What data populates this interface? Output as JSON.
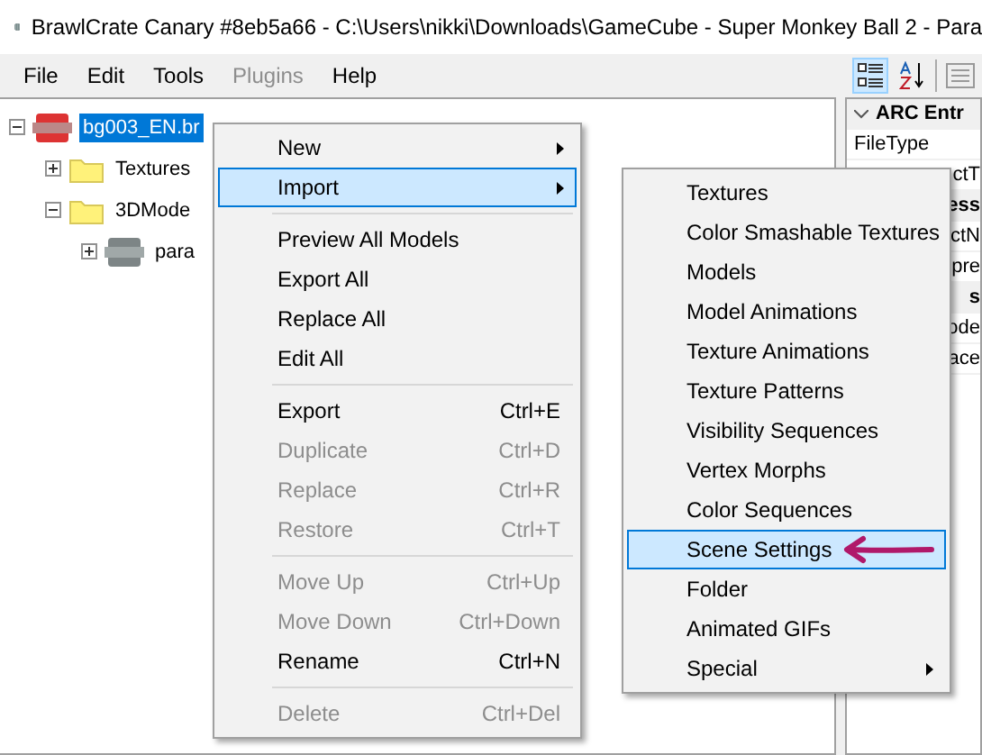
{
  "window": {
    "title": "BrawlCrate Canary #8eb5a66 - C:\\Users\\nikki\\Downloads\\GameCube - Super Monkey Ball 2 - Para"
  },
  "menu_bar": [
    {
      "label": "File",
      "disabled": false
    },
    {
      "label": "Edit",
      "disabled": false
    },
    {
      "label": "Tools",
      "disabled": false
    },
    {
      "label": "Plugins",
      "disabled": true
    },
    {
      "label": "Help",
      "disabled": false
    }
  ],
  "toolbar": [
    {
      "kind": "categorized",
      "selected": true
    },
    {
      "kind": "alphabetical",
      "selected": false
    },
    {
      "kind": "pages",
      "selected": false
    }
  ],
  "tree": [
    {
      "label": "bg003_EN.br",
      "kind": "bres",
      "expanded": true,
      "selected": true,
      "children": [
        {
          "label": "Textures",
          "kind": "folder",
          "expanded": false,
          "selected": false
        },
        {
          "label": "3DMode",
          "kind": "folder",
          "expanded": true,
          "selected": false,
          "children": [
            {
              "label": "para",
              "kind": "model",
              "expanded": false,
              "selected": false
            }
          ]
        }
      ]
    }
  ],
  "properties": [
    {
      "kind": "category",
      "label": "ARC Entr"
    },
    {
      "kind": "property",
      "label": "FileType"
    },
    {
      "kind": "property",
      "label": "ctT"
    },
    {
      "kind": "category",
      "label": "ess"
    },
    {
      "kind": "property",
      "label": "ctN"
    },
    {
      "kind": "property",
      "label": "pre"
    },
    {
      "kind": "category",
      "label": "s"
    },
    {
      "kind": "property",
      "label": "ode"
    },
    {
      "kind": "property",
      "label": "ace"
    }
  ],
  "context_menu": [
    {
      "kind": "item",
      "label": "New",
      "disabled": false,
      "submenu": true,
      "selected": false
    },
    {
      "kind": "item",
      "label": "Import",
      "disabled": false,
      "submenu": true,
      "selected": true
    },
    {
      "kind": "separator"
    },
    {
      "kind": "item",
      "label": "Preview All Models",
      "disabled": false,
      "submenu": false,
      "selected": false
    },
    {
      "kind": "item",
      "label": "Export All",
      "disabled": false,
      "submenu": false,
      "selected": false
    },
    {
      "kind": "item",
      "label": "Replace All",
      "disabled": false,
      "submenu": false,
      "selected": false
    },
    {
      "kind": "item",
      "label": "Edit All",
      "disabled": false,
      "submenu": false,
      "selected": false
    },
    {
      "kind": "separator"
    },
    {
      "kind": "item",
      "label": "Export",
      "shortcut": "Ctrl+E",
      "disabled": false,
      "submenu": false,
      "selected": false
    },
    {
      "kind": "item",
      "label": "Duplicate",
      "shortcut": "Ctrl+D",
      "disabled": true,
      "submenu": false,
      "selected": false
    },
    {
      "kind": "item",
      "label": "Replace",
      "shortcut": "Ctrl+R",
      "disabled": true,
      "submenu": false,
      "selected": false
    },
    {
      "kind": "item",
      "label": "Restore",
      "shortcut": "Ctrl+T",
      "disabled": true,
      "submenu": false,
      "selected": false
    },
    {
      "kind": "separator"
    },
    {
      "kind": "item",
      "label": "Move Up",
      "shortcut": "Ctrl+Up",
      "disabled": true,
      "submenu": false,
      "selected": false
    },
    {
      "kind": "item",
      "label": "Move Down",
      "shortcut": "Ctrl+Down",
      "disabled": true,
      "submenu": false,
      "selected": false
    },
    {
      "kind": "item",
      "label": "Rename",
      "shortcut": "Ctrl+N",
      "disabled": false,
      "submenu": false,
      "selected": false
    },
    {
      "kind": "separator"
    },
    {
      "kind": "item",
      "label": "Delete",
      "shortcut": "Ctrl+Del",
      "disabled": true,
      "submenu": false,
      "selected": false
    }
  ],
  "import_submenu": [
    {
      "label": "Textures",
      "submenu": false,
      "selected": false
    },
    {
      "label": "Color Smashable Textures",
      "submenu": false,
      "selected": false
    },
    {
      "label": "Models",
      "submenu": false,
      "selected": false
    },
    {
      "label": "Model Animations",
      "submenu": false,
      "selected": false
    },
    {
      "label": "Texture Animations",
      "submenu": false,
      "selected": false
    },
    {
      "label": "Texture Patterns",
      "submenu": false,
      "selected": false
    },
    {
      "label": "Visibility Sequences",
      "submenu": false,
      "selected": false
    },
    {
      "label": "Vertex Morphs",
      "submenu": false,
      "selected": false
    },
    {
      "label": "Color Sequences",
      "submenu": false,
      "selected": false
    },
    {
      "label": "Scene Settings",
      "submenu": false,
      "selected": true
    },
    {
      "label": "Folder",
      "submenu": false,
      "selected": false
    },
    {
      "label": "Animated GIFs",
      "submenu": false,
      "selected": false
    },
    {
      "label": "Special",
      "submenu": true,
      "selected": false
    }
  ]
}
